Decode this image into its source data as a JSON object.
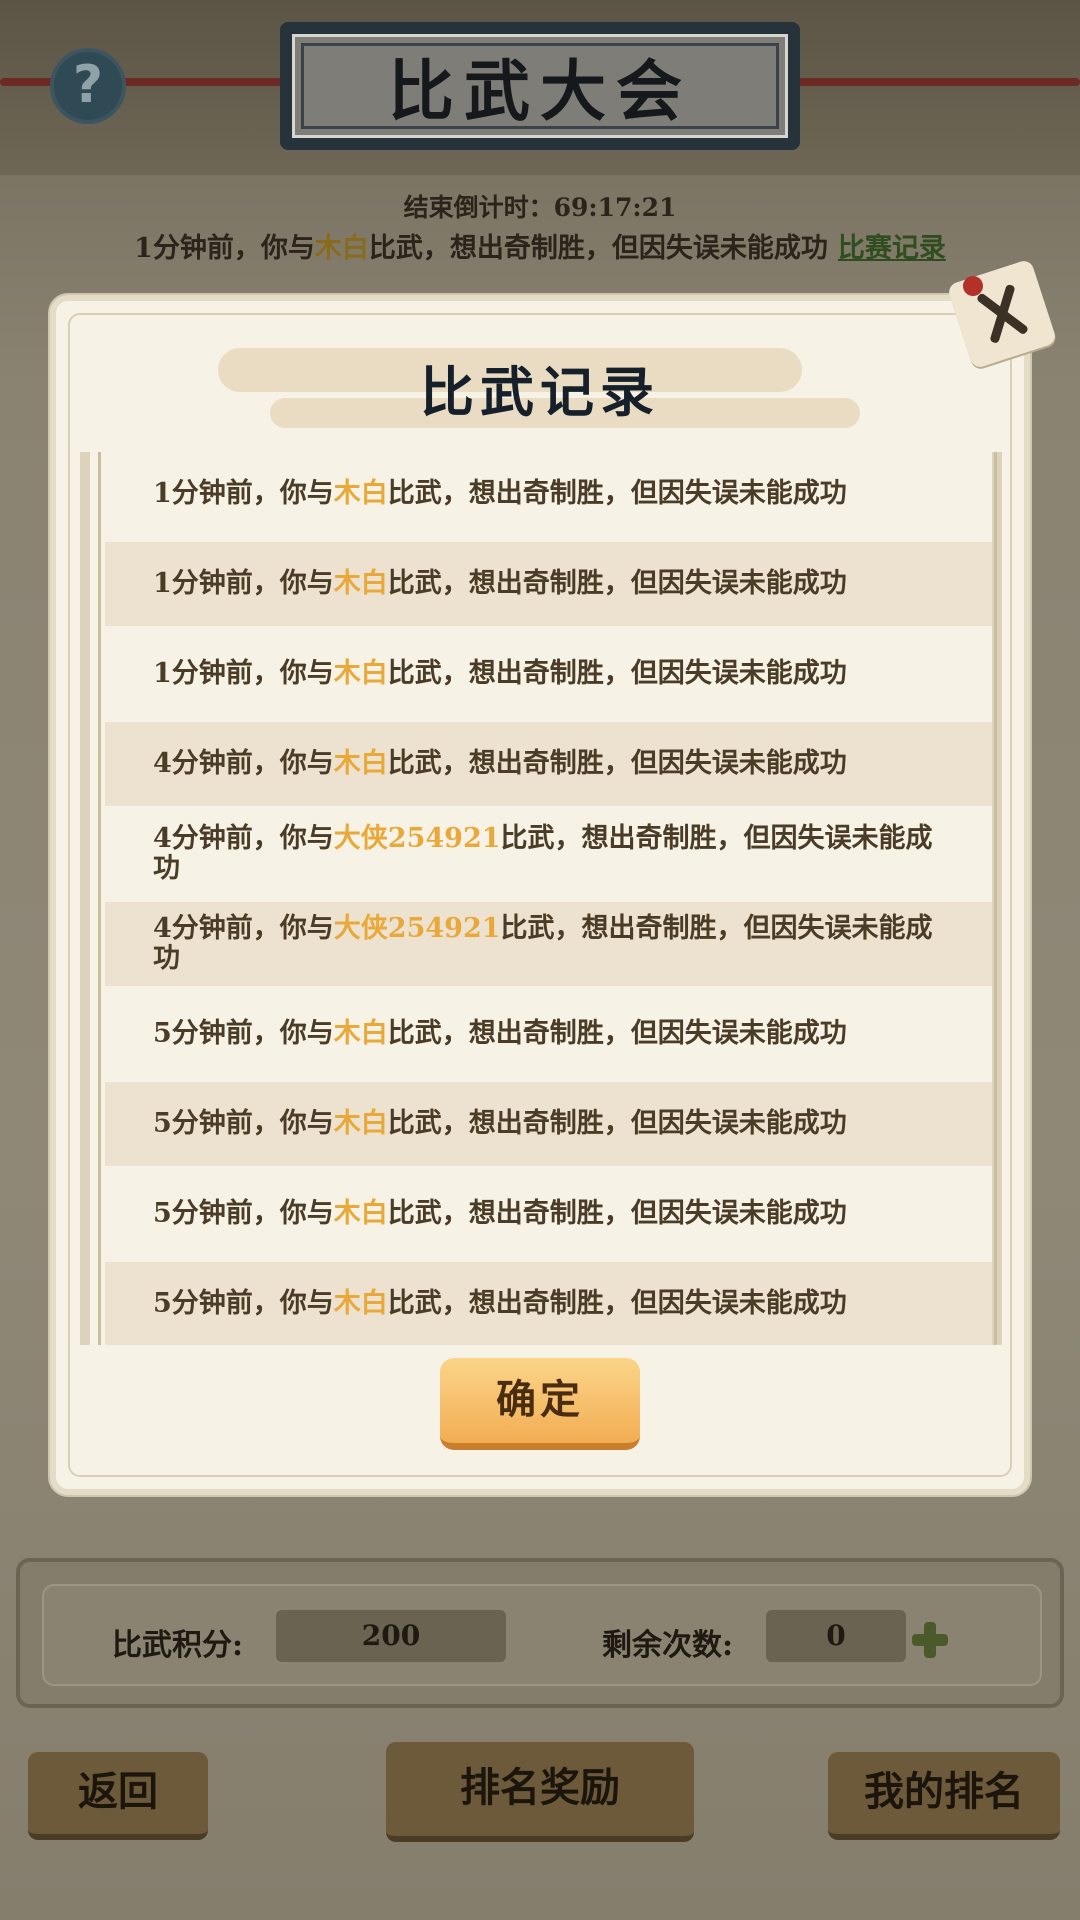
{
  "header": {
    "title": "比武大会",
    "help_icon": "?"
  },
  "status": {
    "countdown": "结束倒计时：69:17:21",
    "last_battle": {
      "prefix": "1分钟前，你与",
      "opponent": "木白",
      "suffix": "比武，想出奇制胜，但因失误未能成功",
      "record_link": "比赛记录"
    }
  },
  "modal": {
    "title": "比武记录",
    "close_icon": "close-x",
    "confirm_label": "确定",
    "records": [
      {
        "prefix": "1分钟前，你与",
        "opponent": "木白",
        "suffix": "比武，想出奇制胜，但因失误未能成功"
      },
      {
        "prefix": "1分钟前，你与",
        "opponent": "木白",
        "suffix": "比武，想出奇制胜，但因失误未能成功"
      },
      {
        "prefix": "1分钟前，你与",
        "opponent": "木白",
        "suffix": "比武，想出奇制胜，但因失误未能成功"
      },
      {
        "prefix": "4分钟前，你与",
        "opponent": "木白",
        "suffix": "比武，想出奇制胜，但因失误未能成功"
      },
      {
        "prefix": "4分钟前，你与",
        "opponent": "大侠254921",
        "suffix": "比武，想出奇制胜，但因失误未能成功"
      },
      {
        "prefix": "4分钟前，你与",
        "opponent": "大侠254921",
        "suffix": "比武，想出奇制胜，但因失误未能成功"
      },
      {
        "prefix": "5分钟前，你与",
        "opponent": "木白",
        "suffix": "比武，想出奇制胜，但因失误未能成功"
      },
      {
        "prefix": "5分钟前，你与",
        "opponent": "木白",
        "suffix": "比武，想出奇制胜，但因失误未能成功"
      },
      {
        "prefix": "5分钟前，你与",
        "opponent": "木白",
        "suffix": "比武，想出奇制胜，但因失误未能成功"
      },
      {
        "prefix": "5分钟前，你与",
        "opponent": "木白",
        "suffix": "比武，想出奇制胜，但因失误未能成功"
      }
    ]
  },
  "score_panel": {
    "points_label": "比武积分:",
    "points_value": "200",
    "remaining_label": "剩余次数:",
    "remaining_value": "0",
    "add_icon": "plus-icon"
  },
  "bottom_buttons": {
    "back": "返回",
    "rank_rewards": "排名奖励",
    "my_rank": "我的排名"
  },
  "colors": {
    "opponent_highlight": "#e9a93a",
    "record_link": "#2f4d1e",
    "confirm_button": "#f2ad53"
  }
}
